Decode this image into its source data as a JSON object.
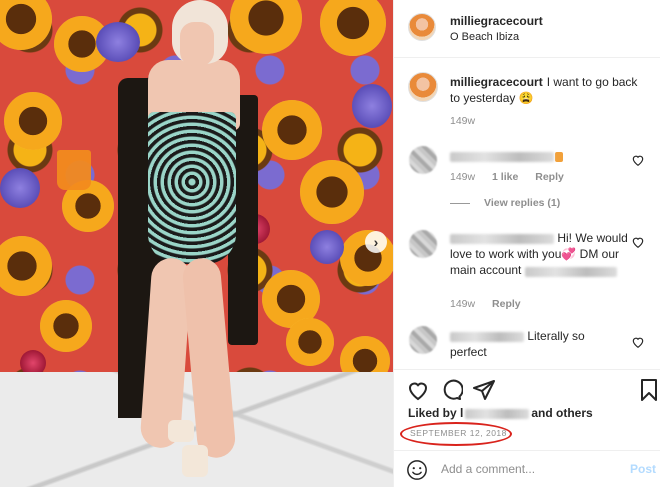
{
  "post": {
    "username": "milliegracecourt",
    "location": "O Beach Ibiza"
  },
  "caption": {
    "username": "milliegracecourt",
    "text": "I want to go back to yesterday 😩",
    "time": "149w"
  },
  "comments": [
    {
      "text_suffix": "",
      "time": "149w",
      "likes": "1 like",
      "reply": "Reply",
      "view_replies": "View replies (1)"
    },
    {
      "text_visible_1": "Hi! We would love to work with you💞",
      "text_visible_2": "DM our main account",
      "time": "149w",
      "reply": "Reply"
    },
    {
      "text_visible": "Literally so perfect"
    }
  ],
  "likes_line": {
    "prefix": "Liked by l",
    "suffix": "and others"
  },
  "date": "SEPTEMBER 12, 2018",
  "add_comment": {
    "placeholder": "Add a comment...",
    "post_label": "Post"
  },
  "colors": {
    "annotation_circle": "#d9231c",
    "post_button": "#b3dbff",
    "meta_gray": "#8e8e8e"
  },
  "icons": [
    "heart-icon",
    "comment-icon",
    "share-icon",
    "bookmark-icon",
    "emoji-icon",
    "chevron-right-icon"
  ]
}
